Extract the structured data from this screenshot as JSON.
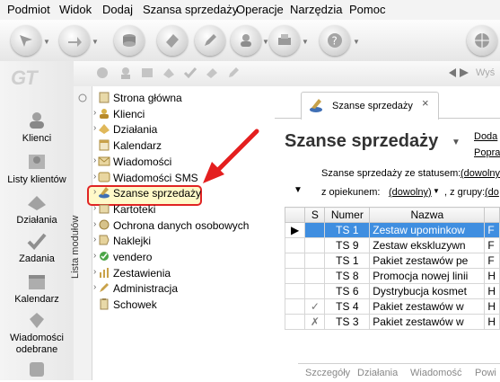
{
  "menu": [
    "Podmiot",
    "Widok",
    "Dodaj",
    "Szansa sprzedaży",
    "Operacje",
    "Narzędzia",
    "Pomoc"
  ],
  "toolbar_right_text": "Wyś",
  "logo_text": "GT",
  "sidebar": [
    {
      "label": "Klienci",
      "icon": "clients-icon"
    },
    {
      "label": "Listy klientów",
      "icon": "client-lists-icon"
    },
    {
      "label": "Działania",
      "icon": "actions-icon"
    },
    {
      "label": "Zadania",
      "icon": "tasks-icon"
    },
    {
      "label": "Kalendarz",
      "icon": "calendar-icon"
    },
    {
      "label": "Wiadomości odebrane",
      "icon": "received-messages-icon"
    }
  ],
  "module_panel_label": "Lista modułów",
  "modules": [
    {
      "label": "Strona główna",
      "icon": "home-page-icon",
      "expandable": false
    },
    {
      "label": "Klienci",
      "icon": "clients-icon",
      "expandable": true
    },
    {
      "label": "Działania",
      "icon": "actions-icon",
      "expandable": true
    },
    {
      "label": "Kalendarz",
      "icon": "calendar-icon",
      "expandable": false
    },
    {
      "label": "Wiadomości",
      "icon": "messages-icon",
      "expandable": true
    },
    {
      "label": "Wiadomości SMS",
      "icon": "sms-icon",
      "expandable": true
    },
    {
      "label": "Szanse sprzedaży",
      "icon": "sales-opportunities-icon",
      "expandable": true,
      "highlighted": true
    },
    {
      "label": "Kartoteki",
      "icon": "records-icon",
      "expandable": true
    },
    {
      "label": "Ochrona danych osobowych",
      "icon": "data-protection-icon",
      "expandable": true
    },
    {
      "label": "Naklejki",
      "icon": "labels-icon",
      "expandable": true
    },
    {
      "label": "vendero",
      "icon": "vendero-icon",
      "expandable": true
    },
    {
      "label": "Zestawienia",
      "icon": "reports-icon",
      "expandable": true
    },
    {
      "label": "Administracja",
      "icon": "administration-icon",
      "expandable": true
    },
    {
      "label": "Schowek",
      "icon": "clipboard-icon",
      "expandable": false
    }
  ],
  "tab": {
    "label": "Szanse sprzedaży",
    "close": "×"
  },
  "page": {
    "title": "Szanse sprzedaży",
    "right_links": [
      "Doda",
      "Popra"
    ],
    "filter1_label": "Szanse sprzedaży ze statusem:",
    "filter1_value": "(dowolny",
    "filter2_label": "z opiekunem:",
    "filter2_value": "(dowolny)",
    "filter3_label": ", z grupy:",
    "filter3_value": "(do"
  },
  "table": {
    "headers": [
      "",
      "S",
      "Numer",
      "Nazwa",
      ""
    ],
    "rows": [
      {
        "indicator": "▶",
        "status": "",
        "number": "TS 1",
        "name": "Zestaw upominkow",
        "extra": "F",
        "selected": true
      },
      {
        "indicator": "",
        "status": "",
        "number": "TS 9",
        "name": "Zestaw ekskluzywn",
        "extra": "F",
        "selected": false
      },
      {
        "indicator": "",
        "status": "",
        "number": "TS 1",
        "name": "Pakiet zestawów pe",
        "extra": "F",
        "selected": false
      },
      {
        "indicator": "",
        "status": "",
        "number": "TS 8",
        "name": "Promocja nowej linii",
        "extra": "H",
        "selected": false
      },
      {
        "indicator": "",
        "status": "",
        "number": "TS 6",
        "name": "Dystrybucja kosmet",
        "extra": "H",
        "selected": false
      },
      {
        "indicator": "",
        "status": "✓",
        "number": "TS 4",
        "name": "Pakiet zestawów w",
        "extra": "H",
        "selected": false
      },
      {
        "indicator": "",
        "status": "✗",
        "number": "TS 3",
        "name": "Pakiet zestawów w",
        "extra": "H",
        "selected": false
      }
    ]
  },
  "bottom_tabs": [
    "Szczegóły",
    "Działania",
    "Wiadomość",
    "Powi"
  ],
  "colors": {
    "highlight_border": "#e02424",
    "arrow": "#e41f1f",
    "selected_row": "#3f8ee0"
  }
}
